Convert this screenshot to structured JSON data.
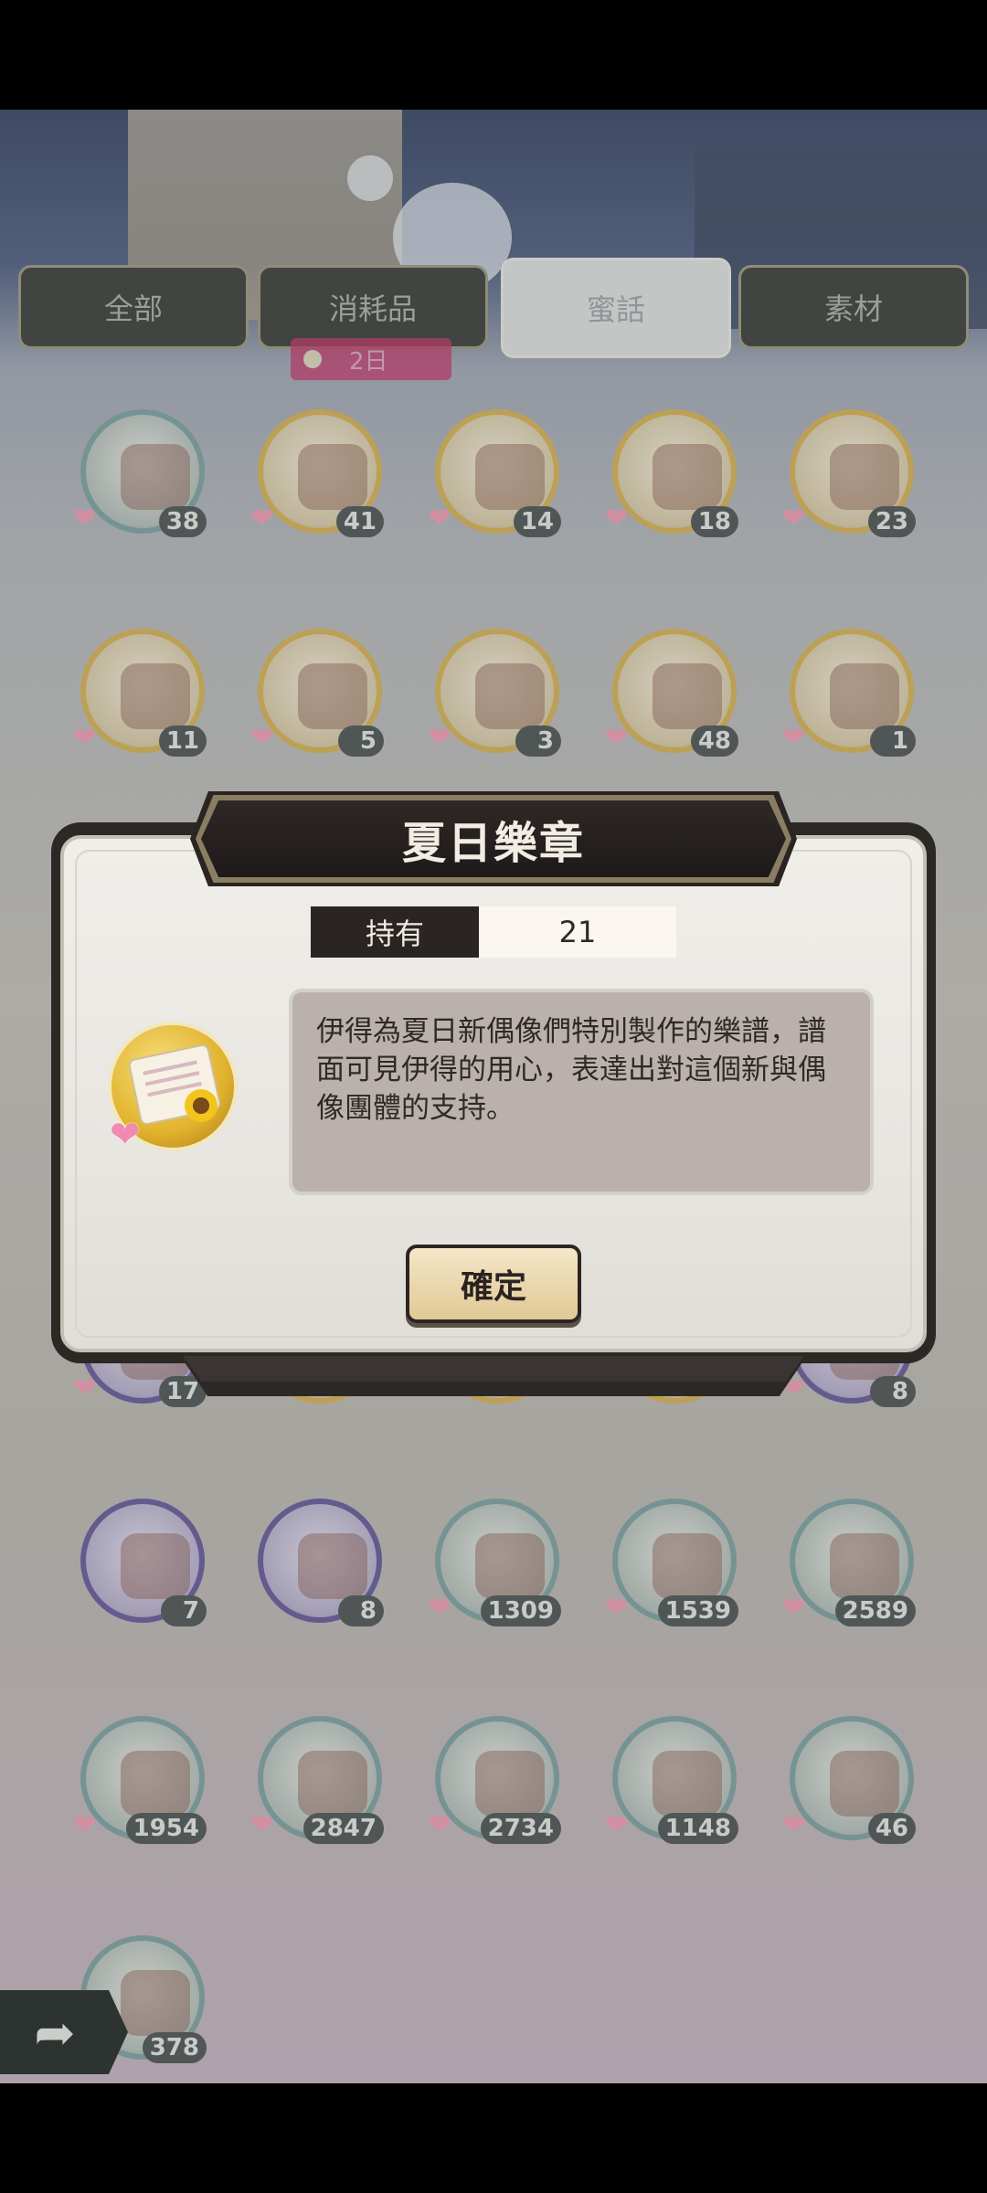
{
  "tabs": [
    {
      "label": "全部"
    },
    {
      "label": "消耗品"
    },
    {
      "label": "蜜話"
    },
    {
      "label": "素材"
    }
  ],
  "tab_badge": {
    "text": "2日"
  },
  "items": [
    {
      "count": "38",
      "ring": "teal"
    },
    {
      "count": "41",
      "ring": "gold"
    },
    {
      "count": "14",
      "ring": "gold"
    },
    {
      "count": "18",
      "ring": "gold"
    },
    {
      "count": "23",
      "ring": "gold"
    },
    {
      "count": "11",
      "ring": "gold"
    },
    {
      "count": "5",
      "ring": "gold"
    },
    {
      "count": "3",
      "ring": "gold"
    },
    {
      "count": "48",
      "ring": "gold"
    },
    {
      "count": "1",
      "ring": "gold"
    },
    {
      "count": "17",
      "ring": "purple"
    },
    {
      "count": "",
      "ring": "gold"
    },
    {
      "count": "",
      "ring": "gold"
    },
    {
      "count": "",
      "ring": "gold"
    },
    {
      "count": "8",
      "ring": "purple"
    },
    {
      "count": "7",
      "ring": "purple"
    },
    {
      "count": "8",
      "ring": "purple"
    },
    {
      "count": "1309",
      "ring": "teal"
    },
    {
      "count": "1539",
      "ring": "teal"
    },
    {
      "count": "2589",
      "ring": "teal"
    },
    {
      "count": "1954",
      "ring": "teal"
    },
    {
      "count": "2847",
      "ring": "teal"
    },
    {
      "count": "2734",
      "ring": "teal"
    },
    {
      "count": "1148",
      "ring": "teal"
    },
    {
      "count": "46",
      "ring": "teal"
    },
    {
      "count": "378",
      "ring": "teal"
    }
  ],
  "dialog": {
    "title": "夏日樂章",
    "owned_label": "持有",
    "owned_value": "21",
    "description": "伊得為夏日新偶像們特別製作的樂譜，譜面可見伊得的用心，表達出對這個新與偶像團體的支持。",
    "confirm_label": "確定"
  },
  "icons": {
    "heart": "heart-icon",
    "back": "back-arrow-icon"
  },
  "colors": {
    "tab_active_bg": "#cfd4d2",
    "badge_bg": "#b7245a",
    "heart": "#f08ab0",
    "button_bg": "#e8d3a6"
  }
}
